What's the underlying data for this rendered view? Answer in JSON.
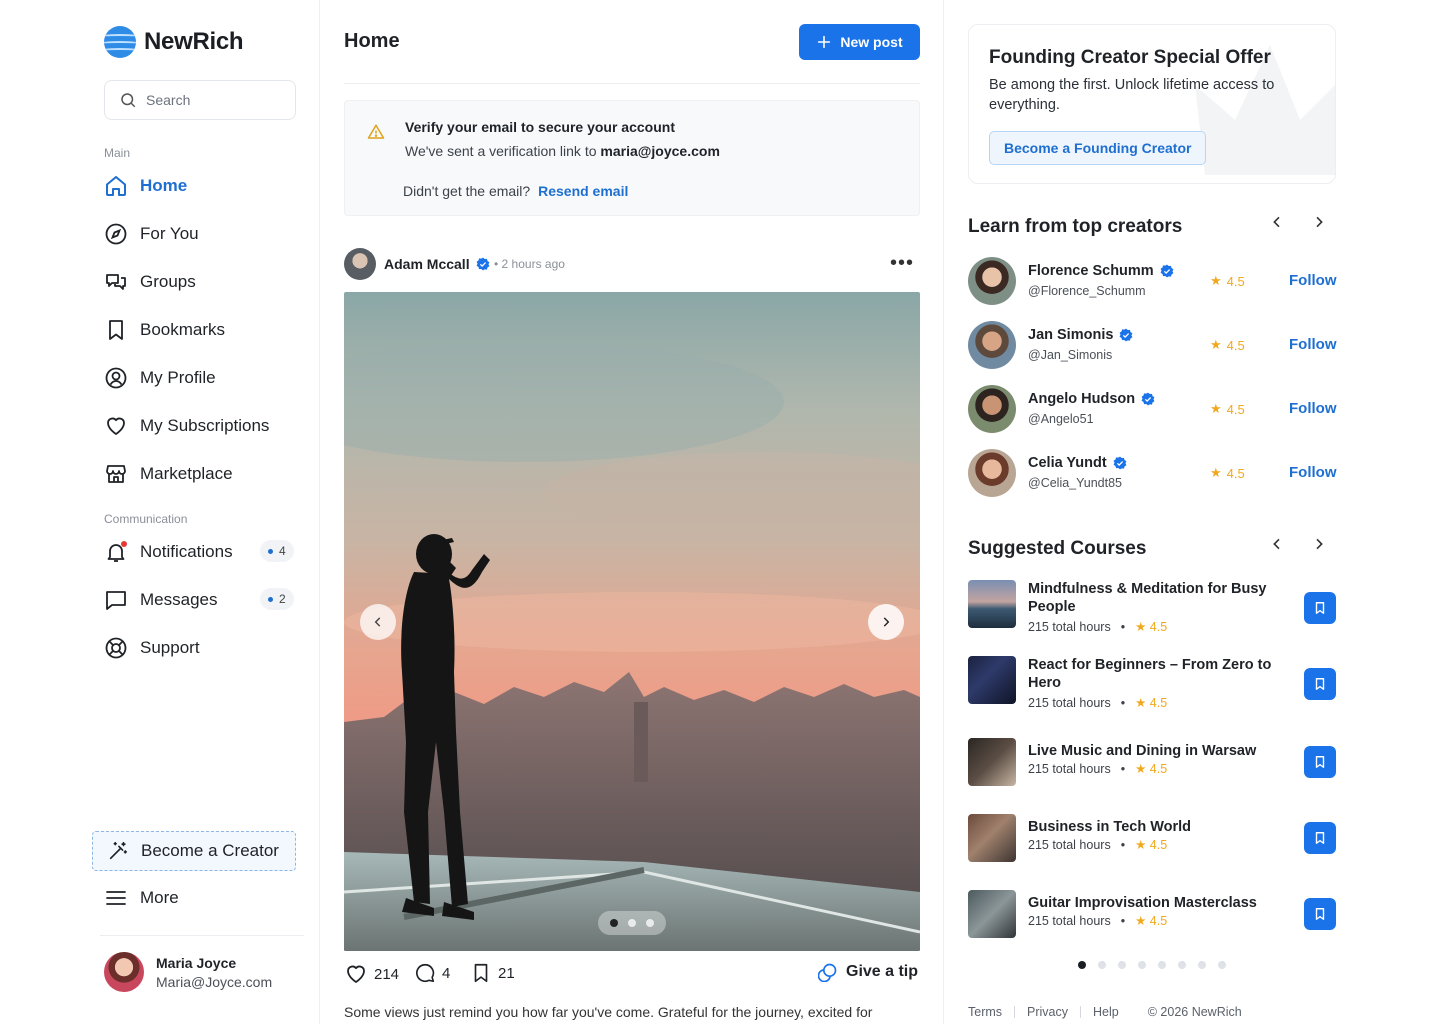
{
  "app": {
    "name": "NewRich"
  },
  "sidebar": {
    "search_placeholder": "Search",
    "section_main": "Main",
    "section_communication": "Communication",
    "items": [
      {
        "label": "Home",
        "icon": "home-icon",
        "active": true
      },
      {
        "label": "For You",
        "icon": "compass-icon"
      },
      {
        "label": "Groups",
        "icon": "groups-icon"
      },
      {
        "label": "Bookmarks",
        "icon": "bookmark-icon"
      },
      {
        "label": "My Profile",
        "icon": "user-circle-icon"
      },
      {
        "label": "My Subscriptions",
        "icon": "heart-icon"
      },
      {
        "label": "Marketplace",
        "icon": "store-icon"
      }
    ],
    "communication": [
      {
        "label": "Notifications",
        "icon": "bell-icon",
        "badge": "4"
      },
      {
        "label": "Messages",
        "icon": "message-icon",
        "badge": "2"
      },
      {
        "label": "Support",
        "icon": "lifebuoy-icon"
      }
    ],
    "become_creator": "Become a Creator",
    "more": "More",
    "user": {
      "name": "Maria Joyce",
      "email": "Maria@Joyce.com"
    }
  },
  "main": {
    "title": "Home",
    "new_post": "New post",
    "verify": {
      "title": "Verify your email to secure your account",
      "text": "We've sent a verification link to",
      "email": "maria@joyce.com",
      "question": "Didn't get the email?",
      "resend": "Resend email"
    },
    "post": {
      "author": "Adam Mccall",
      "time": "2 hours ago",
      "likes": "214",
      "comments": "4",
      "saves": "21",
      "tip": "Give a tip",
      "caption": "Some views just remind you how far you've come. Grateful for the journey, excited for",
      "image_count": 3,
      "image_index": 0
    }
  },
  "right": {
    "offer": {
      "title": "Founding Creator Special Offer",
      "text": "Be among the first. Unlock lifetime access to everything.",
      "button": "Become a Founding Creator"
    },
    "creators_title": "Learn from top creators",
    "creators": [
      {
        "name": "Florence Schumm",
        "handle": "@Florence_Schumm",
        "rating": "4.5",
        "follow": "Follow"
      },
      {
        "name": "Jan Simonis",
        "handle": "@Jan_Simonis",
        "rating": "4.5",
        "follow": "Follow"
      },
      {
        "name": "Angelo Hudson",
        "handle": "@Angelo51",
        "rating": "4.5",
        "follow": "Follow"
      },
      {
        "name": "Celia Yundt",
        "handle": "@Celia_Yundt85",
        "rating": "4.5",
        "follow": "Follow"
      }
    ],
    "courses_title": "Suggested Courses",
    "courses": [
      {
        "title": "Mindfulness & Meditation for Busy People",
        "hours": "215 total hours",
        "rating": "4.5"
      },
      {
        "title": "React for Beginners – From Zero to Hero",
        "hours": "215 total hours",
        "rating": "4.5"
      },
      {
        "title": "Live Music and Dining in Warsaw",
        "hours": "215 total hours",
        "rating": "4.5"
      },
      {
        "title": "Business in Tech World",
        "hours": "215 total hours",
        "rating": "4.5"
      },
      {
        "title": "Guitar Improvisation Masterclass",
        "hours": "215 total hours",
        "rating": "4.5"
      }
    ],
    "course_pages": 8,
    "course_page": 0,
    "footer": {
      "terms": "Terms",
      "privacy": "Privacy",
      "help": "Help",
      "copyright": "© 2026 NewRich"
    }
  },
  "colors": {
    "accent": "#1a73e8",
    "link": "#1f6fd1",
    "star": "#f0a91f",
    "notification_dot": "#e53935"
  }
}
